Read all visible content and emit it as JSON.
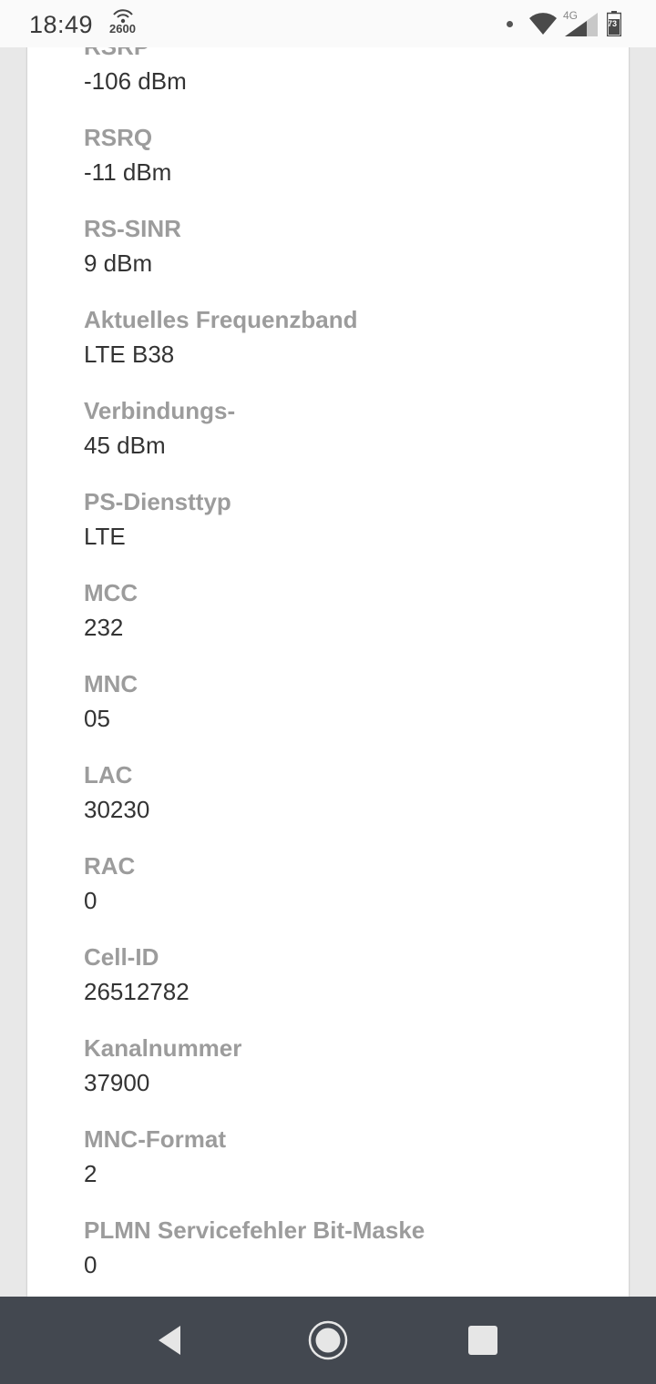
{
  "status_bar": {
    "time": "18:49",
    "hotspot_label": "2600",
    "network_type": "4G",
    "battery_level": "73"
  },
  "fields": [
    {
      "label": "RSRP",
      "value": "-106 dBm"
    },
    {
      "label": "RSRQ",
      "value": "-11 dBm"
    },
    {
      "label": "RS-SINR",
      "value": "9 dBm"
    },
    {
      "label": "Aktuelles Frequenzband",
      "value": "LTE B38"
    },
    {
      "label": "Verbindungs-",
      "value": "45 dBm"
    },
    {
      "label": "PS-Diensttyp",
      "value": "LTE"
    },
    {
      "label": "MCC",
      "value": "232"
    },
    {
      "label": "MNC",
      "value": "05"
    },
    {
      "label": "LAC",
      "value": "30230"
    },
    {
      "label": "RAC",
      "value": "0"
    },
    {
      "label": "Cell-ID",
      "value": "26512782"
    },
    {
      "label": "Kanalnummer",
      "value": "37900"
    },
    {
      "label": "MNC-Format",
      "value": "2"
    },
    {
      "label": "PLMN Servicefehler Bit-Maske",
      "value": "0"
    }
  ],
  "nav": {
    "back_icon": "back-triangle-icon",
    "home_icon": "home-circle-icon",
    "recents_icon": "recents-square-icon"
  }
}
